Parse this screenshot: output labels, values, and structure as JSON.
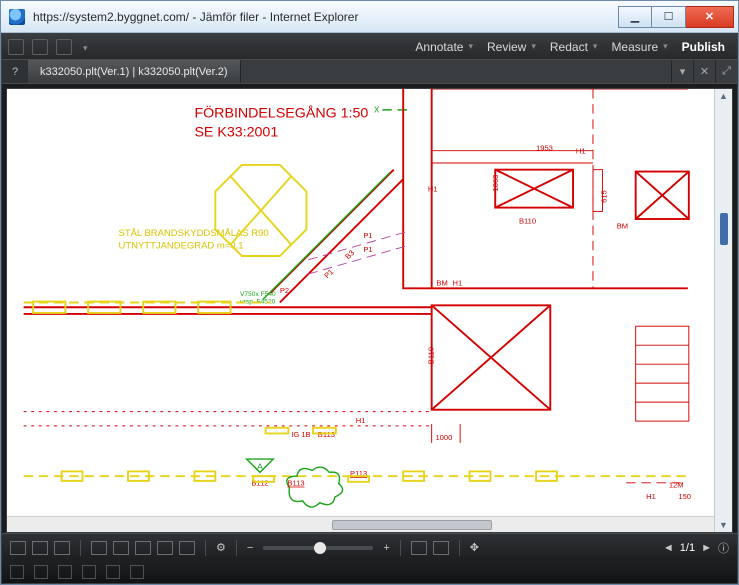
{
  "window": {
    "title": "https://system2.byggnet.com/ - Jämför filer - Internet Explorer"
  },
  "menubar": {
    "annotate": "Annotate",
    "review": "Review",
    "redact": "Redact",
    "measure": "Measure",
    "publish": "Publish"
  },
  "tab": {
    "label": "k332050.plt(Ver.1) | k332050.plt(Ver.2)"
  },
  "cad": {
    "title1": "FÖRBINDELSEGÅNG 1:50",
    "title2": "SE K33:2001",
    "stal1": "STÅL BRANDSKYDDSMÅLAS R90",
    "stal2": "UTNYTTJANDEGRAD m=0,1",
    "green_note": "V750x F540",
    "green_note2": "ursp. F4520",
    "x": "X",
    "b110_a": "B110",
    "b110_b": "B110",
    "H1_a": "H1",
    "H1_b": "H1",
    "H1_c": "H1",
    "BM": "BM",
    "BM2": "BM",
    "d615": "615",
    "d1063": "1063",
    "d1953": "1953",
    "d12m": "12M",
    "d150": "150",
    "IG1B": "IG 1B",
    "B113": "B113",
    "B113b": "B113",
    "A": "A",
    "B112": "B112",
    "P113": "P113",
    "d1000": "1000",
    "P1": "P1",
    "P1b": "P1",
    "B3": "B3",
    "P1c": "P1",
    "P2": "P2"
  },
  "footer": {
    "page_current": "1",
    "page_total": "/1"
  }
}
